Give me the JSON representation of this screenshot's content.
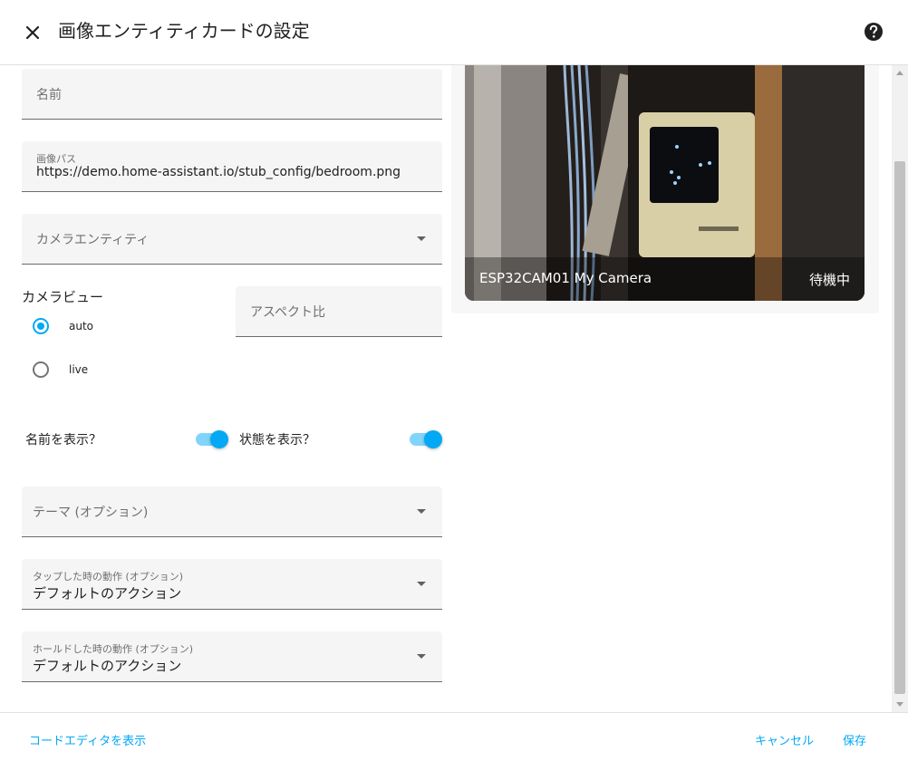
{
  "header": {
    "title": "画像エンティティカードの設定"
  },
  "form": {
    "name_label": "名前",
    "image_path_label": "画像パス",
    "image_path_value": "https://demo.home-assistant.io/stub_config/bedroom.png",
    "camera_entity_label": "カメラエンティティ",
    "camera_view_label": "カメラビュー",
    "camera_view_options": [
      "auto",
      "live"
    ],
    "camera_view_selected": "auto",
    "aspect_ratio_label": "アスペクト比",
    "show_name_label": "名前を表示？",
    "show_name_on": true,
    "show_state_label": "状態を表示？",
    "show_state_on": true,
    "theme_label": "テーマ (オプション)",
    "tap_action_label": "タップした時の動作 (オプション)",
    "tap_action_value": "デフォルトのアクション",
    "hold_action_label": "ホールドした時の動作 (オプション)",
    "hold_action_value": "デフォルトのアクション"
  },
  "preview": {
    "camera_name": "ESP32CAM01 My Camera",
    "camera_state": "待機中"
  },
  "footer": {
    "code_editor_label": "コードエディタを表示",
    "cancel_label": "キャンセル",
    "save_label": "保存"
  },
  "colors": {
    "accent": "#03a9f4",
    "switch_track": "#81d4fa",
    "field_bg": "#f5f5f5"
  }
}
